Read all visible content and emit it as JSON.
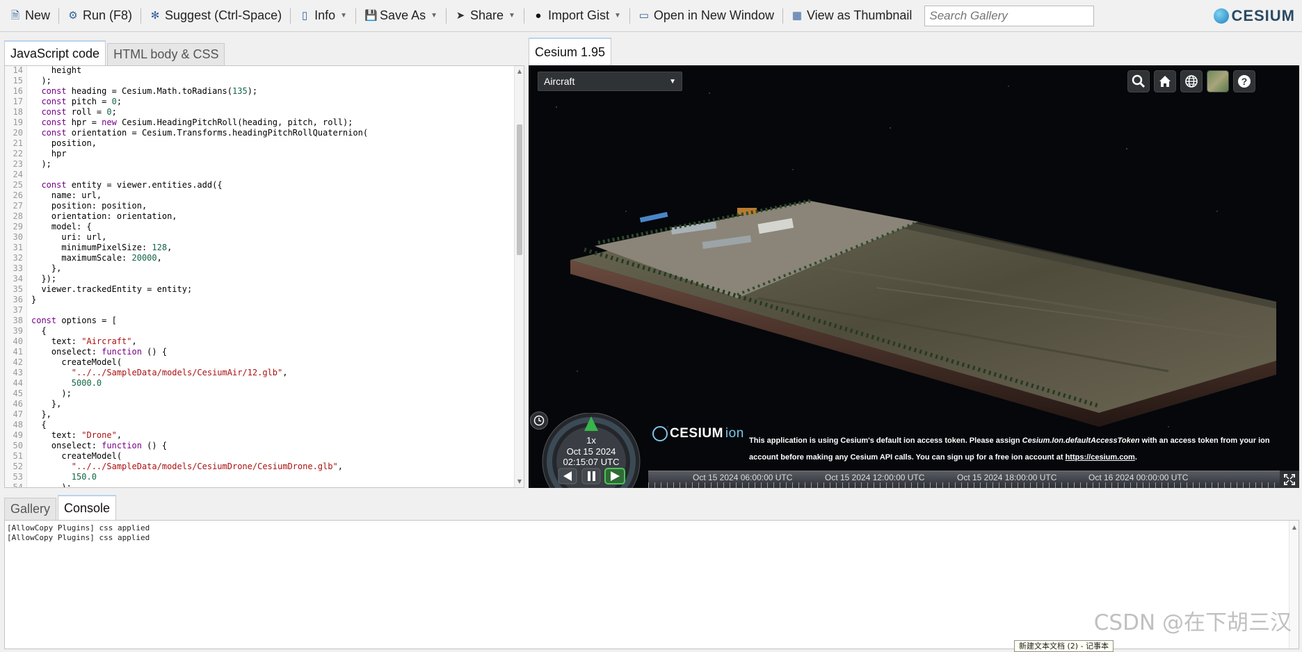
{
  "toolbar": {
    "buttons": [
      {
        "label": "New",
        "icon": "document-icon"
      },
      {
        "label": "Run (F8)",
        "icon": "run-icon"
      },
      {
        "label": "Suggest (Ctrl-Space)",
        "icon": "suggest-icon"
      },
      {
        "label": "Info",
        "icon": "info-icon"
      },
      {
        "label": "Save As",
        "icon": "save-icon"
      },
      {
        "label": "Share",
        "icon": "share-icon"
      },
      {
        "label": "Import Gist",
        "icon": "github-icon"
      },
      {
        "label": "Open in New Window",
        "icon": "window-icon"
      },
      {
        "label": "View as Thumbnail",
        "icon": "thumbnail-icon"
      }
    ],
    "search_placeholder": "Search Gallery",
    "logo": "CESIUM"
  },
  "editor_tabs": {
    "javascript": "JavaScript code",
    "html": "HTML body & CSS"
  },
  "viewer_tab": "Cesium 1.95",
  "code": [
    {
      "n": "14",
      "t": "    height"
    },
    {
      "n": "15",
      "t": "  );"
    },
    {
      "n": "16",
      "t": "  const heading = Cesium.Math.toRadians(135);"
    },
    {
      "n": "17",
      "t": "  const pitch = 0;"
    },
    {
      "n": "18",
      "t": "  const roll = 0;"
    },
    {
      "n": "19",
      "t": "  const hpr = new Cesium.HeadingPitchRoll(heading, pitch, roll);"
    },
    {
      "n": "20",
      "t": "  const orientation = Cesium.Transforms.headingPitchRollQuaternion("
    },
    {
      "n": "21",
      "t": "    position,"
    },
    {
      "n": "22",
      "t": "    hpr"
    },
    {
      "n": "23",
      "t": "  );"
    },
    {
      "n": "24",
      "t": ""
    },
    {
      "n": "25",
      "t": "  const entity = viewer.entities.add({"
    },
    {
      "n": "26",
      "t": "    name: url,"
    },
    {
      "n": "27",
      "t": "    position: position,"
    },
    {
      "n": "28",
      "t": "    orientation: orientation,"
    },
    {
      "n": "29",
      "t": "    model: {"
    },
    {
      "n": "30",
      "t": "      uri: url,"
    },
    {
      "n": "31",
      "t": "      minimumPixelSize: 128,"
    },
    {
      "n": "32",
      "t": "      maximumScale: 20000,"
    },
    {
      "n": "33",
      "t": "    },"
    },
    {
      "n": "34",
      "t": "  });"
    },
    {
      "n": "35",
      "t": "  viewer.trackedEntity = entity;"
    },
    {
      "n": "36",
      "t": "}"
    },
    {
      "n": "37",
      "t": ""
    },
    {
      "n": "38",
      "t": "const options = ["
    },
    {
      "n": "39",
      "t": "  {"
    },
    {
      "n": "40",
      "t": "    text: \"Aircraft\","
    },
    {
      "n": "41",
      "t": "    onselect: function () {"
    },
    {
      "n": "42",
      "t": "      createModel("
    },
    {
      "n": "43",
      "t": "        \"../../SampleData/models/CesiumAir/12.glb\","
    },
    {
      "n": "44",
      "t": "        5000.0"
    },
    {
      "n": "45",
      "t": "      );"
    },
    {
      "n": "46",
      "t": "    },"
    },
    {
      "n": "47",
      "t": "  },"
    },
    {
      "n": "48",
      "t": "  {"
    },
    {
      "n": "49",
      "t": "    text: \"Drone\","
    },
    {
      "n": "50",
      "t": "    onselect: function () {"
    },
    {
      "n": "51",
      "t": "      createModel("
    },
    {
      "n": "52",
      "t": "        \"../../SampleData/models/CesiumDrone/CesiumDrone.glb\","
    },
    {
      "n": "53",
      "t": "        150.0"
    },
    {
      "n": "54",
      "t": "      );"
    }
  ],
  "viewer": {
    "model_select": "Aircraft",
    "animation": {
      "speed": "1x",
      "date": "Oct 15 2024",
      "time": "02:15:07 UTC"
    },
    "credit": {
      "logo": "CESIUM",
      "logo_suffix": "ion",
      "text_1": "This application is using Cesium's default ion access token. Please assign ",
      "text_em": "Cesium.Ion.defaultAccessToken",
      "text_2": " with an access token from your ion account before making any Cesium API calls. You can sign up for a free ion account at ",
      "link": "https://cesium.com",
      "text_3": "."
    },
    "timeline_labels": [
      "Oct 15 2024 06:00:00 UTC",
      "Oct 15 2024 12:00:00 UTC",
      "Oct 15 2024 18:00:00 UTC",
      "Oct 16 2024 00:00:00 UTC"
    ]
  },
  "bottom_tabs": {
    "gallery": "Gallery",
    "console": "Console"
  },
  "console_lines": [
    "[AllowCopy Plugins] css applied",
    "[AllowCopy Plugins] css applied"
  ],
  "watermark": "CSDN @在下胡三汉",
  "taskbar_tip": "新建文本文档 (2) - 记事本"
}
